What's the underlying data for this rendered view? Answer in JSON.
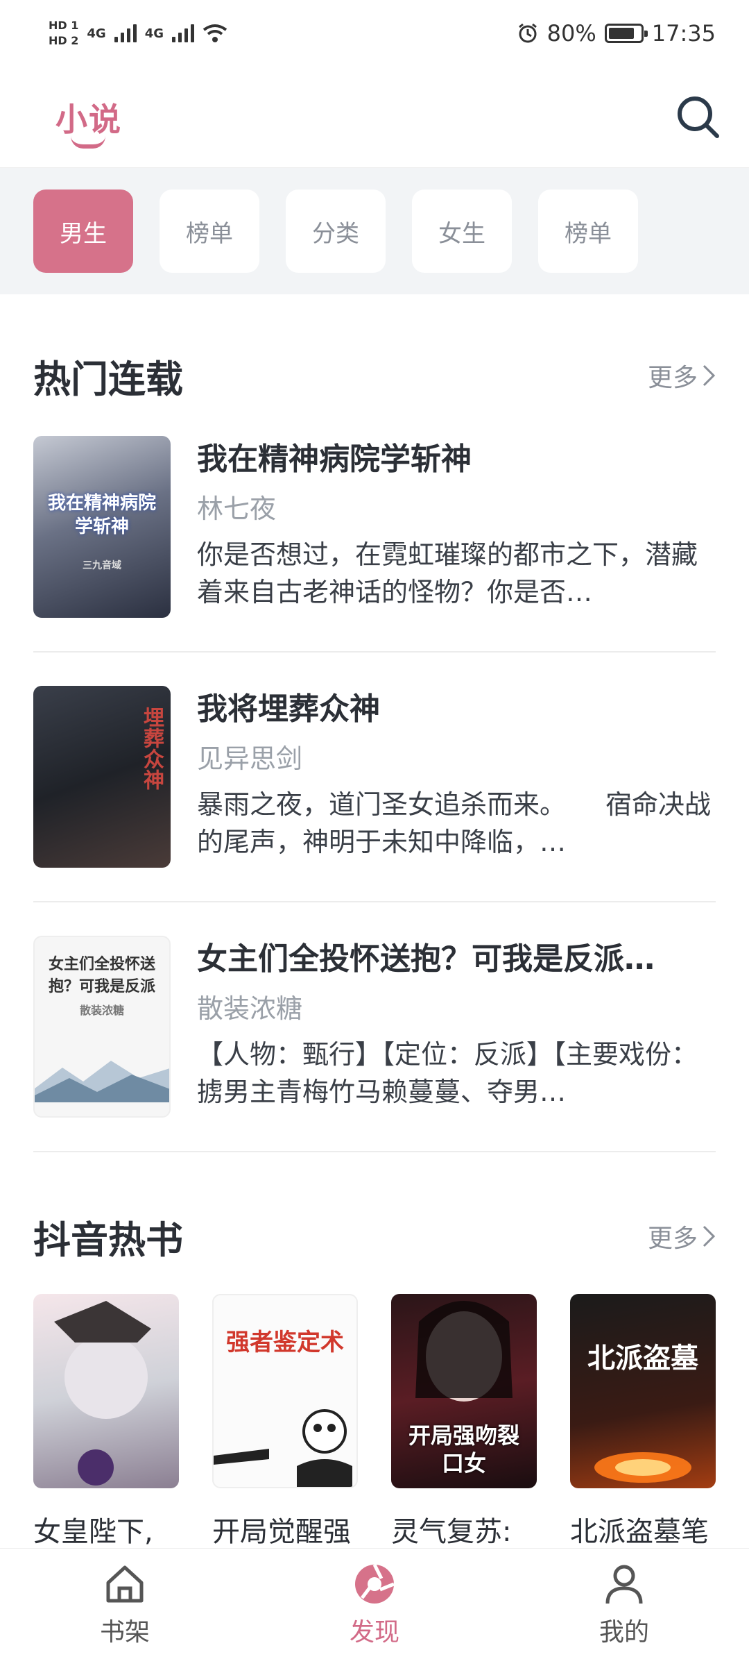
{
  "status_bar": {
    "hd1": "HD 1",
    "hd2": "HD 2",
    "net1": "4G",
    "net2": "4G",
    "battery": "80%",
    "time": "17:35"
  },
  "header": {
    "logo": "小说",
    "search_icon": "search-icon"
  },
  "filters": [
    {
      "label": "男生",
      "active": true
    },
    {
      "label": "榜单",
      "active": false
    },
    {
      "label": "分类",
      "active": false
    },
    {
      "label": "女生",
      "active": false
    },
    {
      "label": "榜单",
      "active": false
    }
  ],
  "section_serial": {
    "title": "热门连载",
    "more": "更多",
    "books": [
      {
        "title": "我在精神病院学斩神",
        "author": "林七夜",
        "description": "你是否想过，在霓虹璀璨的都市之下，潜藏着来自古老神话的怪物？你是否…",
        "cover_text": "我在精神病院学斩神",
        "cover_author": "三九音域"
      },
      {
        "title": "我将埋葬众神",
        "author": "见异思剑",
        "description": "暴雨之夜，道门圣女追杀而来。　　宿命决战的尾声，神明于未知中降临，…",
        "cover_text": "埋葬众神"
      },
      {
        "title": "女主们全投怀送抱？可我是反派…",
        "author": "散装浓糖",
        "description": "【人物：甄行】【定位：反派】【主要戏份：掳男主青梅竹马赖蔓蔓、夺男…",
        "cover_text": "女主们全投怀送抱？可我是反派",
        "cover_author": "散装浓糖"
      }
    ]
  },
  "section_douyin": {
    "title": "抖音热书",
    "more": "更多",
    "books": [
      {
        "title": "女皇陛下,",
        "cover_text": ""
      },
      {
        "title": "开局觉醒强",
        "cover_text": "强者鉴定术"
      },
      {
        "title": "灵气复苏:",
        "cover_text": "开局强吻裂口女"
      },
      {
        "title": "北派盗墓笔",
        "cover_text": "北派盗墓"
      }
    ]
  },
  "tabbar": [
    {
      "label": "书架",
      "icon": "home-icon",
      "active": false
    },
    {
      "label": "发现",
      "icon": "discover-icon",
      "active": true
    },
    {
      "label": "我的",
      "icon": "profile-icon",
      "active": false
    }
  ],
  "colors": {
    "accent": "#d6728a",
    "text": "#2b2f36",
    "muted": "#9aa0a8"
  }
}
